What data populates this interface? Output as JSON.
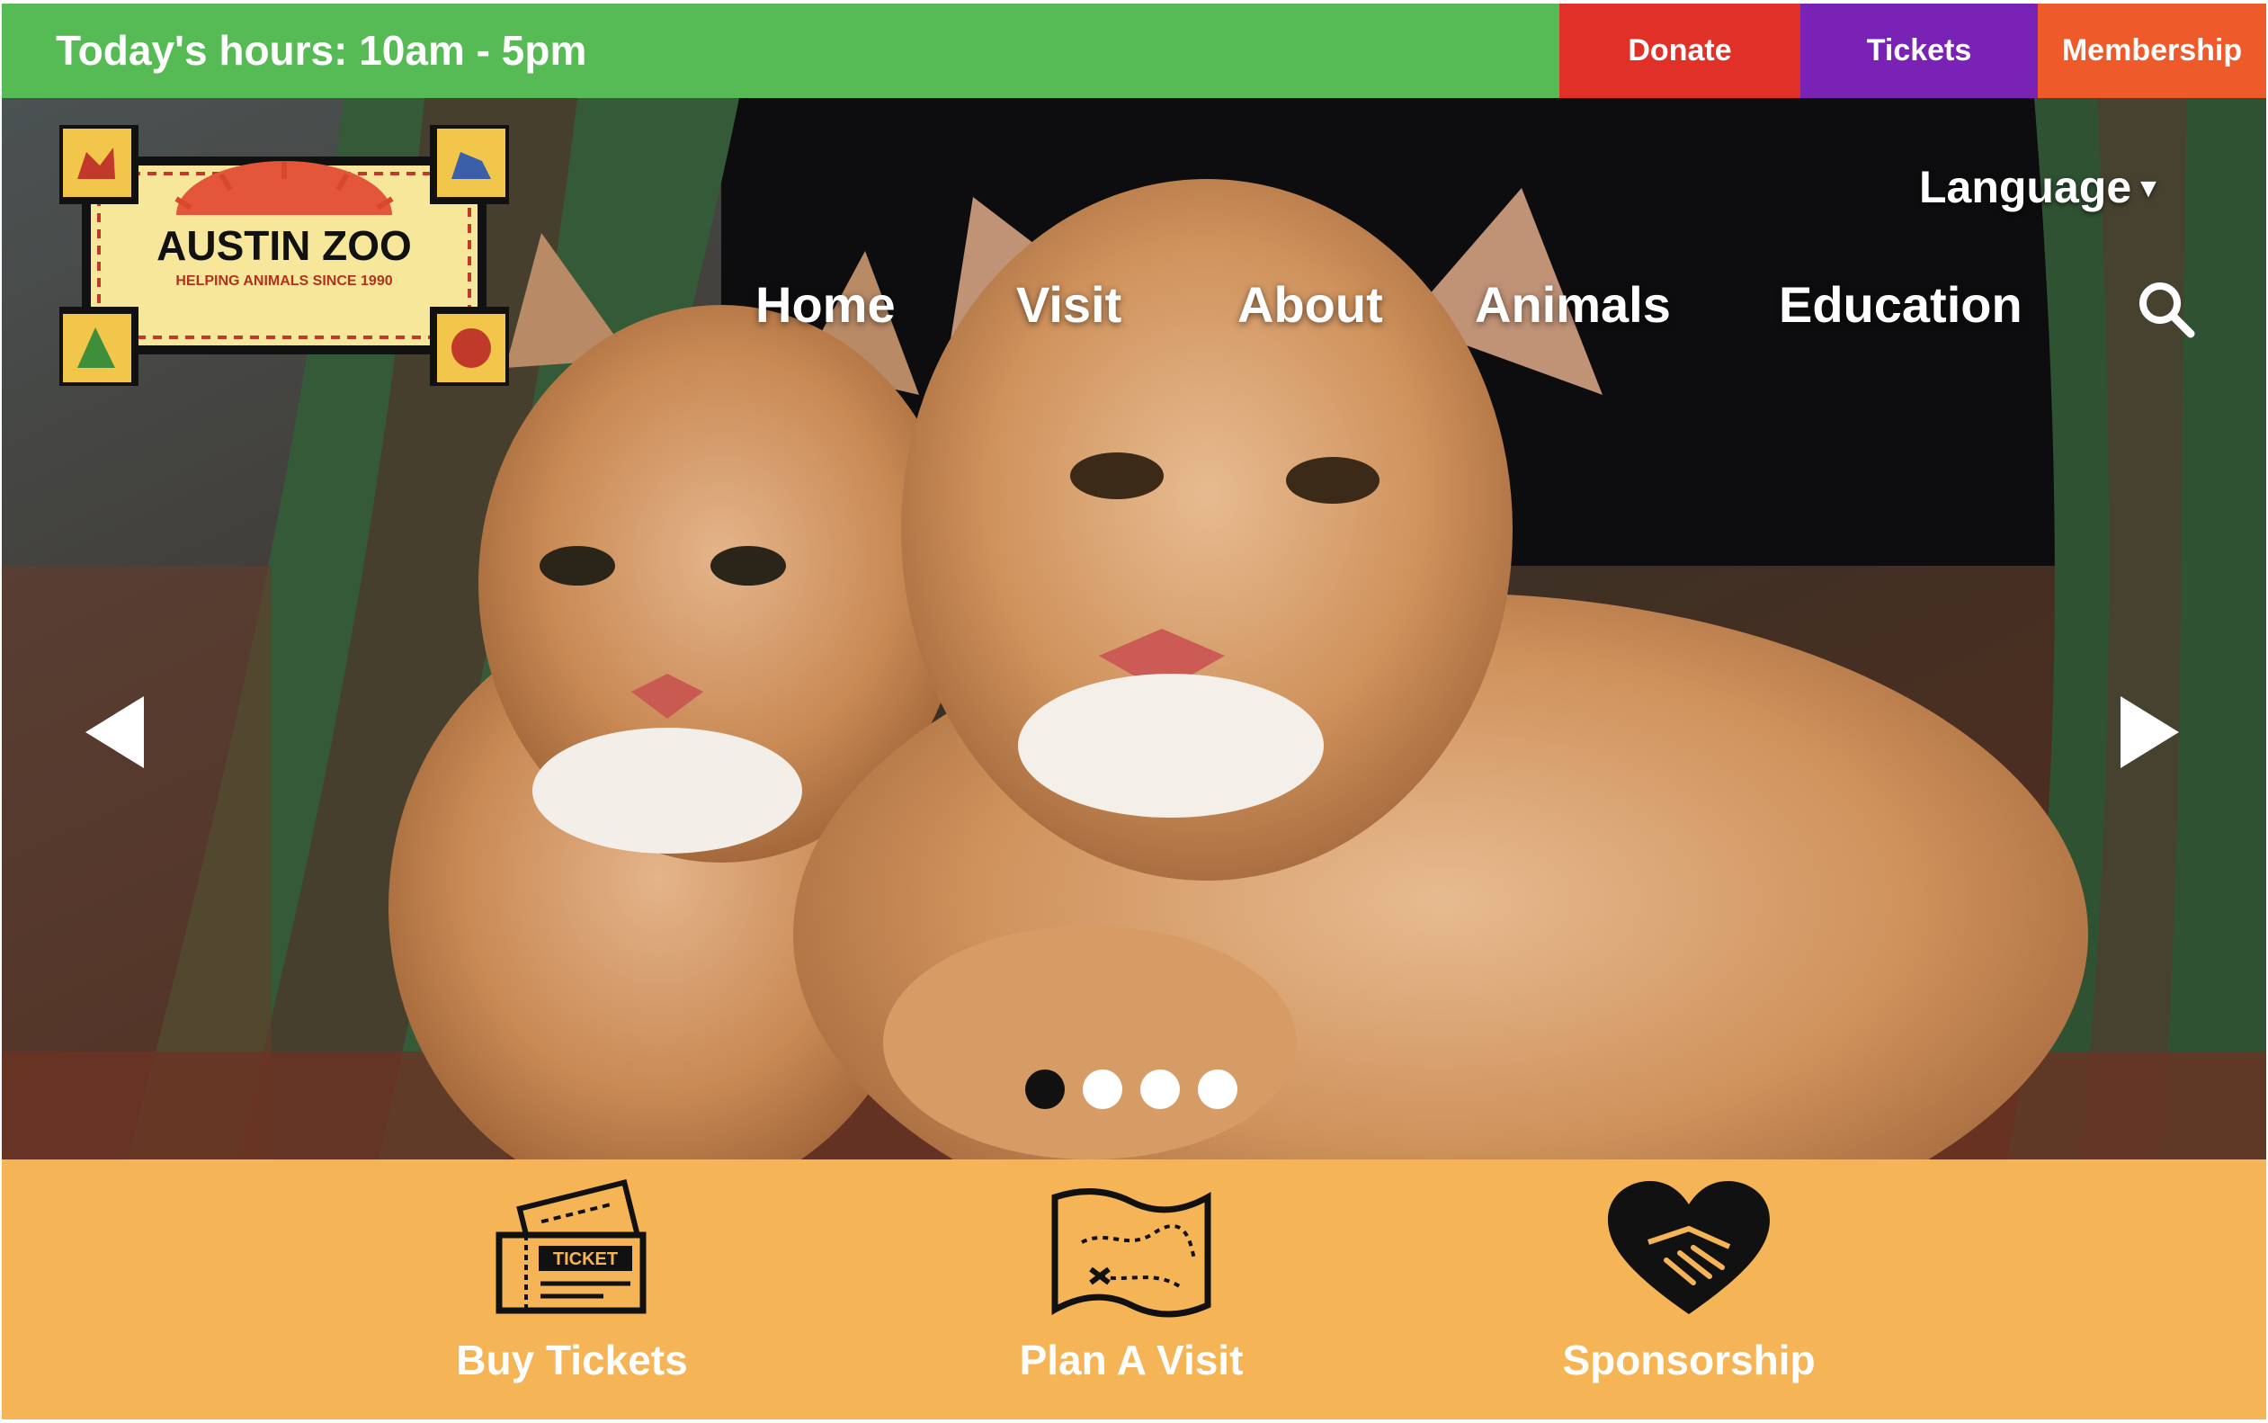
{
  "topbar": {
    "hours": "Today's hours: 10am - 5pm",
    "donate": "Donate",
    "tickets": "Tickets",
    "membership": "Membership"
  },
  "logo": {
    "title": "AUSTIN ZOO",
    "tagline": "HELPING ANIMALS SINCE 1990"
  },
  "header": {
    "language": "Language",
    "nav": [
      "Home",
      "Visit",
      "About",
      "Animals",
      "Education"
    ]
  },
  "carousel": {
    "slide_count": 4,
    "active_index": 0
  },
  "quick_links": [
    {
      "label": "Buy Tickets",
      "icon": "ticket-icon"
    },
    {
      "label": "Plan A Visit",
      "icon": "map-icon"
    },
    {
      "label": "Sponsorship",
      "icon": "heart-handshake-icon"
    }
  ],
  "ticket_icon_text": "TICKET",
  "colors": {
    "topbar": "#57bb55",
    "donate": "#e13028",
    "tickets": "#7a22b5",
    "membership": "#ef5a2a",
    "quick_strip": "#f5b456"
  }
}
